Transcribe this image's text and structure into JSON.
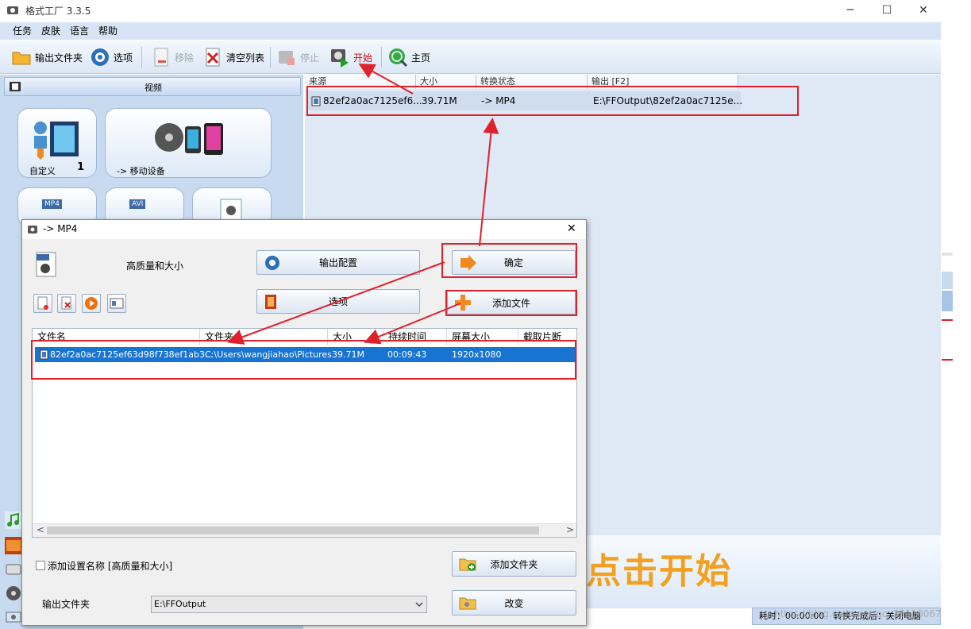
{
  "app": {
    "title": "格式工厂 3.3.5",
    "window_buttons": {
      "minimize": "─",
      "maximize": "☐",
      "close": "✕"
    }
  },
  "menu": [
    "任务",
    "皮肤",
    "语言",
    "帮助"
  ],
  "toolbar": {
    "output_folder": "输出文件夹",
    "options": "选项",
    "remove": "移除",
    "clear_list": "清空列表",
    "stop": "停止",
    "start": "开始",
    "home": "主页"
  },
  "left_panel": {
    "category": "视频",
    "tiles": {
      "custom_label": "自定义",
      "custom_count": "1",
      "mobile_label": "-> 移动设备",
      "mp4_badge": "MP4",
      "avi_badge": "AVI"
    }
  },
  "task_list": {
    "columns": [
      "来源",
      "大小",
      "转换状态",
      "输出 [F2]"
    ],
    "rows": [
      {
        "source": "82ef2a0ac7125ef6...",
        "size": "39.71M",
        "status": "-> MP4",
        "output": "E:\\FFOutput\\82ef2a0ac7125e..."
      }
    ]
  },
  "overlay_text": "点击开始",
  "status_bar": {
    "elapsed": "耗时：00:00:00",
    "after_convert": "转换完成后：关闭电脑",
    "watermark": "https://blog.csdn.net/qq_38110067"
  },
  "dialog": {
    "title": "-> MP4",
    "close": "✕",
    "quality_label": "高质量和大小",
    "buttons": {
      "output_config": "输出配置",
      "ok": "确定",
      "options": "选项",
      "add_file": "添加文件",
      "add_folder": "添加文件夹",
      "change": "改变"
    },
    "file_columns": [
      "文件名",
      "文件夹",
      "大小",
      "持续时间",
      "屏幕大小",
      "截取片断"
    ],
    "files": [
      {
        "name": "82ef2a0ac7125ef63d98f738ef1ab3...",
        "folder": "C:\\Users\\wangjiahao\\Pictures",
        "size": "39.71M",
        "duration": "00:09:43",
        "resolution": "1920x1080",
        "clip": ""
      }
    ],
    "add_setting_name": "添加设置名称 [高质量和大小]",
    "output_folder_label": "输出文件夹",
    "output_folder_value": "E:\\FFOutput"
  },
  "colors": {
    "annotation_red": "#e0202a",
    "selection_blue": "#1874d0",
    "overlay_orange": "#f3a020"
  }
}
